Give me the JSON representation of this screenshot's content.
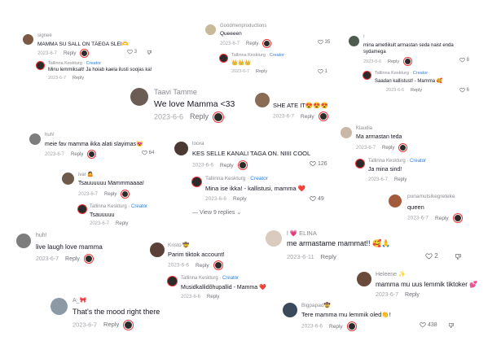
{
  "creator_label": "Creator",
  "reply_label": "Reply",
  "view_replies": "View 9 replies",
  "c1": {
    "user": "signee",
    "text": "MAMMA SU SALL ON TÄEGA SLEI🫶",
    "date": "2023-6-7",
    "likes": "3"
  },
  "c1r": {
    "user": "Tallinna Keskturg",
    "text": "Minu lemmiksalt! Ja hoiab kaela ilusti soojas ka!",
    "date": "2023-6-7"
  },
  "c2": {
    "user": "Goodmenproductions",
    "text": "Queeeen",
    "date": "2023-6-7",
    "likes": "35"
  },
  "c2r": {
    "user": "Tallinna Keskturg",
    "text": "👑👑👑",
    "date": "2023-6-7",
    "likes": "1"
  },
  "c3": {
    "user": "!",
    "text": "mina ametlikult armastan seda naist enda sydamega",
    "date": "2023-6-6",
    "likes": "8"
  },
  "c3r": {
    "user": "Tallinna Keskturg",
    "text": "Saadan kallistust! - Mamma 🥰",
    "date": "2023-6-6",
    "likes": "6"
  },
  "c4": {
    "user": "Taavi Tamme",
    "text": "We love Mamma <33",
    "date": "2023-6-6"
  },
  "c5": {
    "user": "",
    "text": "SHE ATE IT😍😍😍",
    "date": "2023-6-7"
  },
  "c6": {
    "user": "Klaudia",
    "text": "Ma armastan teda",
    "date": "2023-6-7"
  },
  "c6r": {
    "user": "Tallinna Keskturg",
    "text": "Ja mina sind!",
    "date": "2023-6-7"
  },
  "c7": {
    "user": "huh!",
    "text": "meie fav mamma ikka alati slayimas😻",
    "date": "2023-6-7",
    "likes": "64"
  },
  "c8": {
    "user": "loora",
    "text": "KES SELLE KANALI TAGA ON. NIIII COOL",
    "date": "2023-6-6",
    "likes": "126"
  },
  "c8r": {
    "user": "Tallinna Keskturg",
    "text": "Mina ise ikka! - kallistusi, mamma ❤️",
    "date": "2023-6-6",
    "likes": "49"
  },
  "c9": {
    "user": "ivar 🤷",
    "text": "Tsauuuuuu Mammmaaaa!",
    "date": "2023-6-7"
  },
  "c9r": {
    "user": "Tallinna Keskturg",
    "text": "Tsauuuuu",
    "date": "2023-6-7"
  },
  "c10": {
    "user": "punamutsikegreteke",
    "text": "queen",
    "date": "2023-6-7"
  },
  "c11": {
    "user": "huh!",
    "text": "live laugh love mamma",
    "date": "2023-6-7"
  },
  "c12": {
    "user": "Kristo 🤠",
    "text": "Parim tiktok account!",
    "date": "2023-6-6"
  },
  "c12r": {
    "user": "Tallinna Keskturg",
    "text": "Musidkallidõhupallid - Mamma ❤️",
    "date": "2023-6-6"
  },
  "c13": {
    "user": "l 💗 ELINA",
    "text": "me armastame mammat!! 🥰🙏",
    "date": "2023-6-11",
    "likes": "2"
  },
  "c14": {
    "user": "Heleene ✨",
    "text": "mamma mu uus lemmik tiktoker 💕",
    "date": "2023-6-7"
  },
  "c15": {
    "user": "A_🎀",
    "text": "That's the mood right there",
    "date": "2023-6-7"
  },
  "c16": {
    "user": "Bigpapad🤠",
    "text": "Tere mamma mu lemmik oled👏!",
    "date": "2023-6-6",
    "likes": "438"
  }
}
